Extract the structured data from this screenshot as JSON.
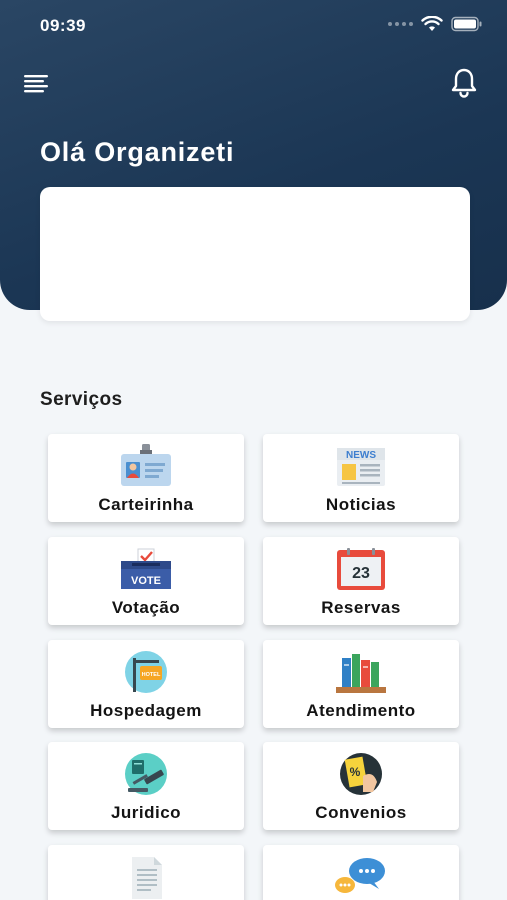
{
  "status_bar": {
    "time": "09:39"
  },
  "header": {
    "greeting": "Olá Organizeti"
  },
  "services": {
    "title": "Serviços",
    "items": [
      {
        "label": "Carteirinha",
        "icon": "id-card-icon"
      },
      {
        "label": "Noticias",
        "icon": "newspaper-icon"
      },
      {
        "label": "Votação",
        "icon": "ballot-box-icon"
      },
      {
        "label": "Reservas",
        "icon": "calendar-icon",
        "calendar_day": "23"
      },
      {
        "label": "Hospedagem",
        "icon": "hotel-sign-icon",
        "sign_text": "HOTEL"
      },
      {
        "label": "Atendimento",
        "icon": "bookshelf-icon"
      },
      {
        "label": "Juridico",
        "icon": "gavel-icon"
      },
      {
        "label": "Convenios",
        "icon": "discount-tag-icon"
      },
      {
        "label": "",
        "icon": "document-icon"
      },
      {
        "label": "",
        "icon": "chat-bubbles-icon"
      }
    ],
    "ballot_text": "VOTE",
    "news_text": "NEWS"
  },
  "colors": {
    "header": "#1f3a58",
    "background": "#f3f6f9",
    "card": "#ffffff"
  }
}
